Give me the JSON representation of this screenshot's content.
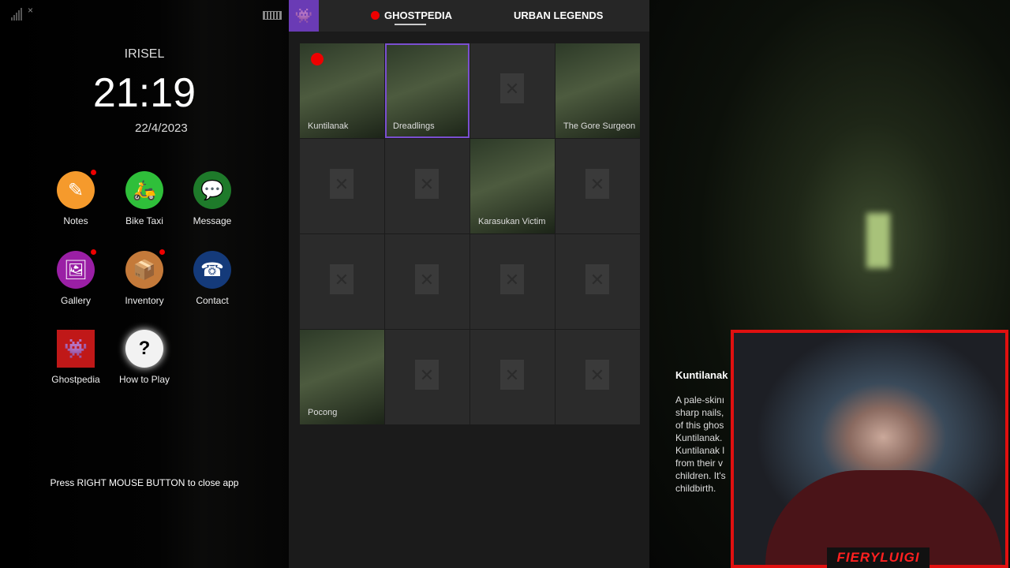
{
  "phone": {
    "owner": "IRISEL",
    "time": "21:19",
    "date": "22/4/2023",
    "hint": "Press RIGHT MOUSE BUTTON to close app",
    "apps": [
      {
        "label": "Notes",
        "icon": "✎",
        "color": "#f59a2c",
        "badge": true
      },
      {
        "label": "Bike Taxi",
        "icon": "🛵",
        "color": "#2fbf3a",
        "badge": false
      },
      {
        "label": "Message",
        "icon": "💬",
        "color": "#1e7a2a",
        "badge": false
      },
      {
        "label": "Gallery",
        "icon": "🖼",
        "color": "#9a1fa5",
        "badge": true
      },
      {
        "label": "Inventory",
        "icon": "📦",
        "color": "#c47a3a",
        "badge": true
      },
      {
        "label": "Contact",
        "icon": "☎",
        "color": "#143a7a",
        "badge": false
      },
      {
        "label": "Ghostpedia",
        "icon": "👾",
        "color": "#c01818",
        "badge": false
      },
      {
        "label": "How to Play",
        "icon": "?",
        "color": "#f2f2f2",
        "badge": false
      }
    ]
  },
  "ghostpedia": {
    "tabs": [
      "GHOSTPEDIA",
      "URBAN LEGENDS"
    ],
    "entries": [
      {
        "name": "Kuntilanak",
        "image": true,
        "new": true
      },
      {
        "name": "Dreadlings",
        "image": true,
        "selected": true
      },
      {
        "name": "",
        "image": false
      },
      {
        "name": "The Gore Surgeon",
        "image": true
      },
      {
        "name": "",
        "image": false
      },
      {
        "name": "",
        "image": false
      },
      {
        "name": "Karasukan Victim",
        "image": true
      },
      {
        "name": "",
        "image": false
      },
      {
        "name": "",
        "image": false
      },
      {
        "name": "",
        "image": false
      },
      {
        "name": "",
        "image": false
      },
      {
        "name": "",
        "image": false
      },
      {
        "name": "Pocong",
        "image": true
      },
      {
        "name": "",
        "image": false
      },
      {
        "name": "",
        "image": false
      },
      {
        "name": "",
        "image": false
      }
    ]
  },
  "detail": {
    "title": "Kuntilanak",
    "lines": [
      "A pale-skinı",
      "sharp nails,",
      "of this ghos",
      "Kuntilanak.",
      "Kuntilanak l",
      "from their v",
      "children. It's",
      "childbirth."
    ]
  },
  "webcam": {
    "name": "FIERYLUIGI"
  }
}
